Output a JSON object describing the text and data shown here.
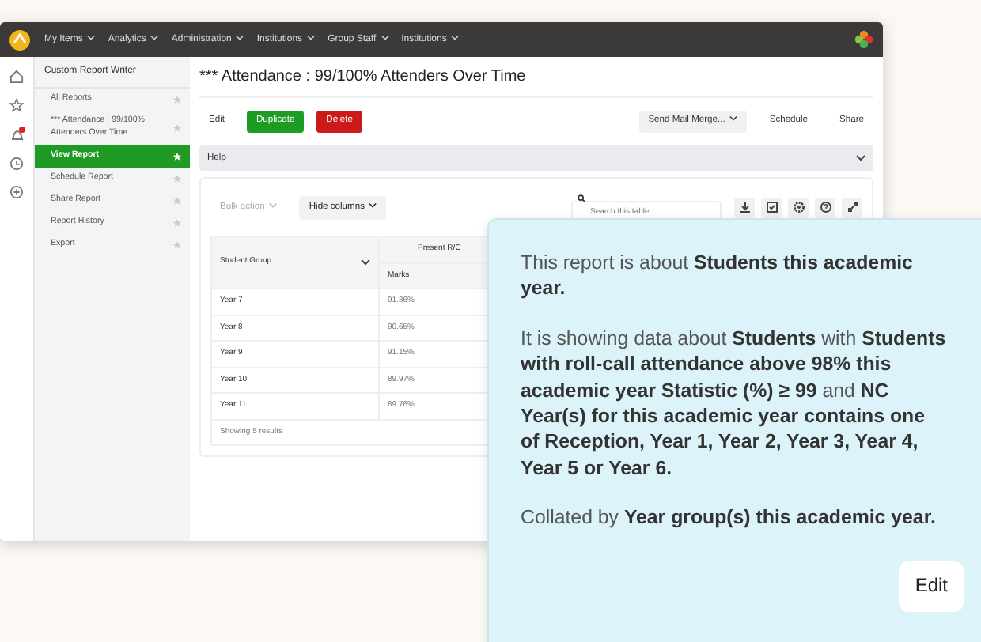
{
  "topbar": {
    "menus": [
      {
        "label": "My Items"
      },
      {
        "label": "Analytics"
      },
      {
        "label": "Administration"
      },
      {
        "label": "Institutions"
      },
      {
        "label": "Group Staff"
      },
      {
        "label": "Institutions"
      }
    ]
  },
  "sidebar": {
    "title": "Custom Report Writer",
    "items": [
      {
        "label": "All Reports",
        "selected": false
      },
      {
        "label": "*** Attendance : 99/100% Attenders Over Time",
        "selected": false
      },
      {
        "label": "View Report",
        "selected": true
      },
      {
        "label": "Schedule Report",
        "selected": false
      },
      {
        "label": "Share Report",
        "selected": false
      },
      {
        "label": "Report History",
        "selected": false
      },
      {
        "label": "Export",
        "selected": false
      }
    ]
  },
  "report": {
    "title": "*** Attendance : 99/100% Attenders Over Time",
    "actions": [
      {
        "label": "Edit",
        "kind": "plain"
      },
      {
        "label": "Duplicate",
        "kind": "success"
      },
      {
        "label": "Delete",
        "kind": "danger"
      }
    ],
    "right_actions": [
      {
        "label": "Send Mail Merge...",
        "kind": "dropdown"
      },
      {
        "label": "Schedule",
        "kind": "plain"
      },
      {
        "label": "Share",
        "kind": "plain"
      }
    ],
    "help": "Help"
  },
  "table": {
    "bulk_action": {
      "label": "Bulk action",
      "disabled": true
    },
    "hide_columns": {
      "label": "Hide columns",
      "disabled": false
    },
    "search": {
      "placeholder": "Search this table"
    },
    "columns": [
      {
        "label": "Student Group"
      },
      {
        "label": "Present R/C",
        "sub": "Marks"
      }
    ],
    "rows": [
      [
        "Year 7",
        "91.36%"
      ],
      [
        "Year 8",
        "90.65%"
      ],
      [
        "Year 9",
        "91.15%"
      ],
      [
        "Year 10",
        "89.97%"
      ],
      [
        "Year 11",
        "89.76%"
      ]
    ],
    "footer": "Showing 5 results"
  },
  "popup": {
    "paragraphs": [
      "This report is about **Students this academic year.**",
      "It is showing data about **Students** with **Students with roll-call attendance above 98% this academic year Statistic (%) ≥ 99** and **NC Year(s) for this academic year contains one of Reception, Year 1, Year 2, Year 3, Year 4, Year 5 or Year 6.**",
      "Collated by **Year group(s) this academic year.**"
    ],
    "edit": "Edit"
  }
}
